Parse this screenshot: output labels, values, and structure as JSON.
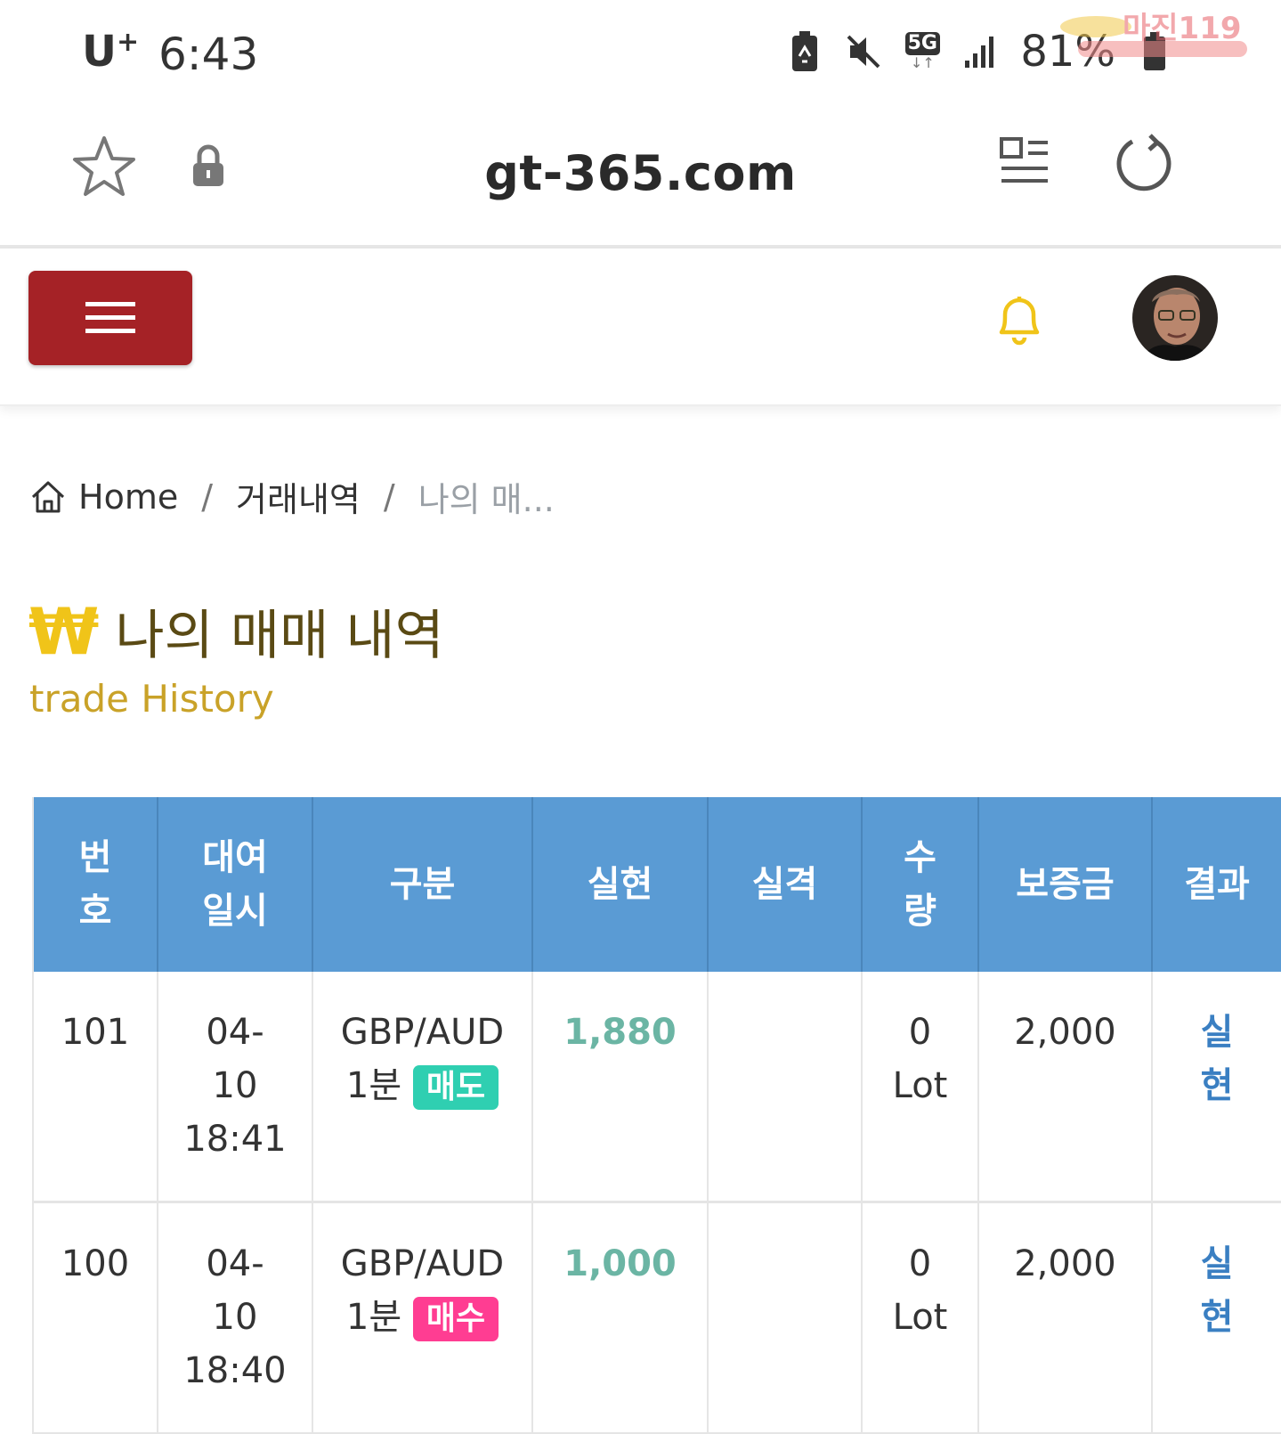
{
  "status_bar": {
    "carrier": "U",
    "carrier_sup": "+",
    "time": "6:43",
    "network": "5G",
    "battery": "81%",
    "watermark_text": "마진119"
  },
  "browser": {
    "url": "gt-365.com"
  },
  "breadcrumb": {
    "home": "Home",
    "separator": "/",
    "level1": "거래내역",
    "current": "나의 매..."
  },
  "page": {
    "currency_symbol": "₩",
    "title": "나의 매매 내역",
    "subtitle": "trade History"
  },
  "table": {
    "headers": [
      "번호",
      "대여일시",
      "구분",
      "실현",
      "실격",
      "수량",
      "보증금",
      "결과"
    ],
    "rows": [
      {
        "no": "101",
        "date": "04-10",
        "time": "18:41",
        "pair": "GBP/AUD",
        "period": "1분",
        "side": "매도",
        "realized": "1,880",
        "disq": "",
        "qty": "0",
        "unit": "Lot",
        "deposit": "2,000",
        "result": "실현"
      },
      {
        "no": "100",
        "date": "04-10",
        "time": "18:40",
        "pair": "GBP/AUD",
        "period": "1분",
        "side": "매수",
        "realized": "1,000",
        "disq": "",
        "qty": "0",
        "unit": "Lot",
        "deposit": "2,000",
        "result": "실현"
      }
    ]
  },
  "colors": {
    "menu_button": "#a52226",
    "table_header": "#5a9bd4",
    "sell_tag": "#2fcfb1",
    "buy_tag": "#ff3d92",
    "realized": "#6bb5a4",
    "result": "#3a7fc2",
    "bell": "#f0c419"
  }
}
